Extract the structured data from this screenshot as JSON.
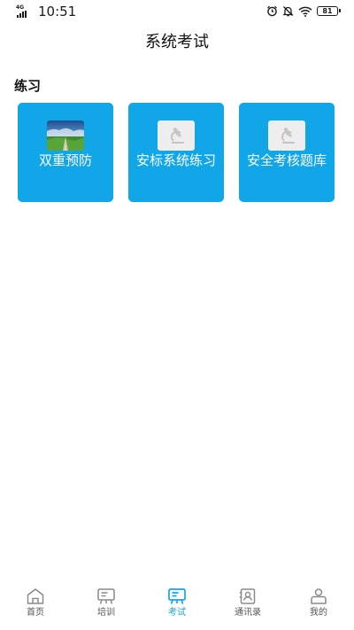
{
  "status_bar": {
    "network": "4G",
    "time": "10:51",
    "battery": "81"
  },
  "header": {
    "title": "系统考试"
  },
  "section": {
    "title": "练习"
  },
  "tiles": [
    {
      "label": "双重预防",
      "icon": "landscape-image"
    },
    {
      "label": "安标系统练习",
      "icon": "image-placeholder"
    },
    {
      "label": "安全考核题库",
      "icon": "image-placeholder"
    }
  ],
  "nav": {
    "items": [
      {
        "label": "首页",
        "icon": "home-icon"
      },
      {
        "label": "培训",
        "icon": "training-icon"
      },
      {
        "label": "考试",
        "icon": "exam-icon"
      },
      {
        "label": "通讯录",
        "icon": "contacts-icon"
      },
      {
        "label": "我的",
        "icon": "profile-icon"
      }
    ],
    "active_index": 2
  },
  "colors": {
    "accent": "#11a6e8",
    "text": "#1a1a1a",
    "inactive_icon": "#8a8a8a"
  }
}
